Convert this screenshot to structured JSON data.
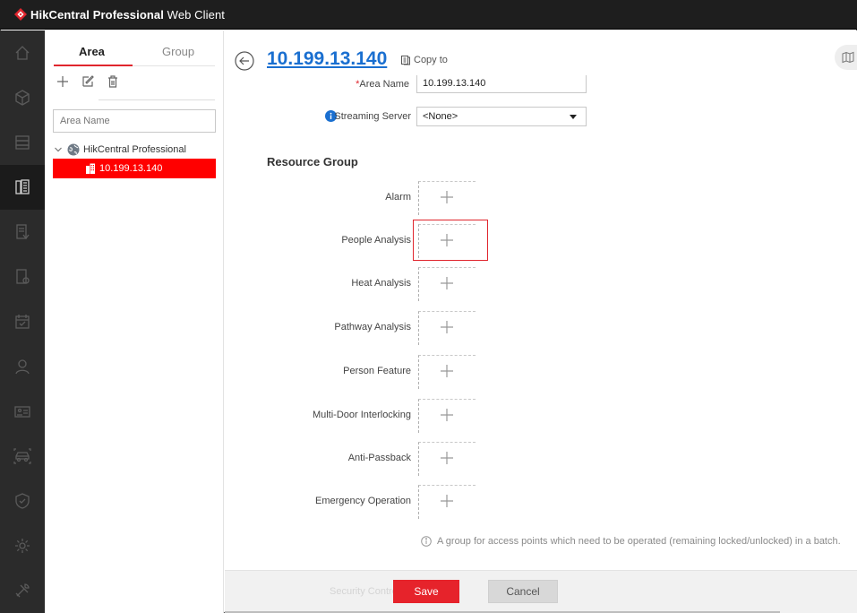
{
  "app": {
    "title_bold": "HikCentral Professional",
    "title_rest": " Web Client",
    "brand_color": "#e0252d"
  },
  "rail": {
    "icons": [
      "home-icon",
      "cube-icon",
      "server-icon",
      "building-list-icon",
      "report-icon",
      "video-file-icon",
      "calendar-check-icon",
      "person-icon",
      "id-card-icon",
      "vehicle-icon",
      "shield-icon",
      "gear-icon",
      "tools-icon"
    ],
    "active": "building-list-icon"
  },
  "area_panel": {
    "tabs": [
      "Area",
      "Group"
    ],
    "active_tab": "Area",
    "search": {
      "placeholder": "Area Name"
    },
    "tree": {
      "root": "HikCentral Professional",
      "child": "10.199.13.140"
    }
  },
  "header": {
    "title": "10.199.13.140",
    "copy_to": "Copy to"
  },
  "form": {
    "area_name": {
      "required_mark": "*",
      "label": "Area Name",
      "value": "10.199.13.140"
    },
    "streaming_server": {
      "label": "Streaming Server",
      "value": "<None>"
    }
  },
  "resource_group": {
    "title": "Resource Group",
    "items": [
      "Alarm",
      "People Analysis",
      "Heat Analysis",
      "Pathway Analysis",
      "Person Feature",
      "Multi-Door Interlocking",
      "Anti-Passback",
      "Emergency Operation"
    ],
    "highlighted": "People Analysis"
  },
  "note": "A group for access points which need to be operated (remaining locked/unlocked) in a batch.",
  "footer": {
    "ghost_label": "Security Control Partition",
    "save": "Save",
    "cancel": "Cancel"
  }
}
